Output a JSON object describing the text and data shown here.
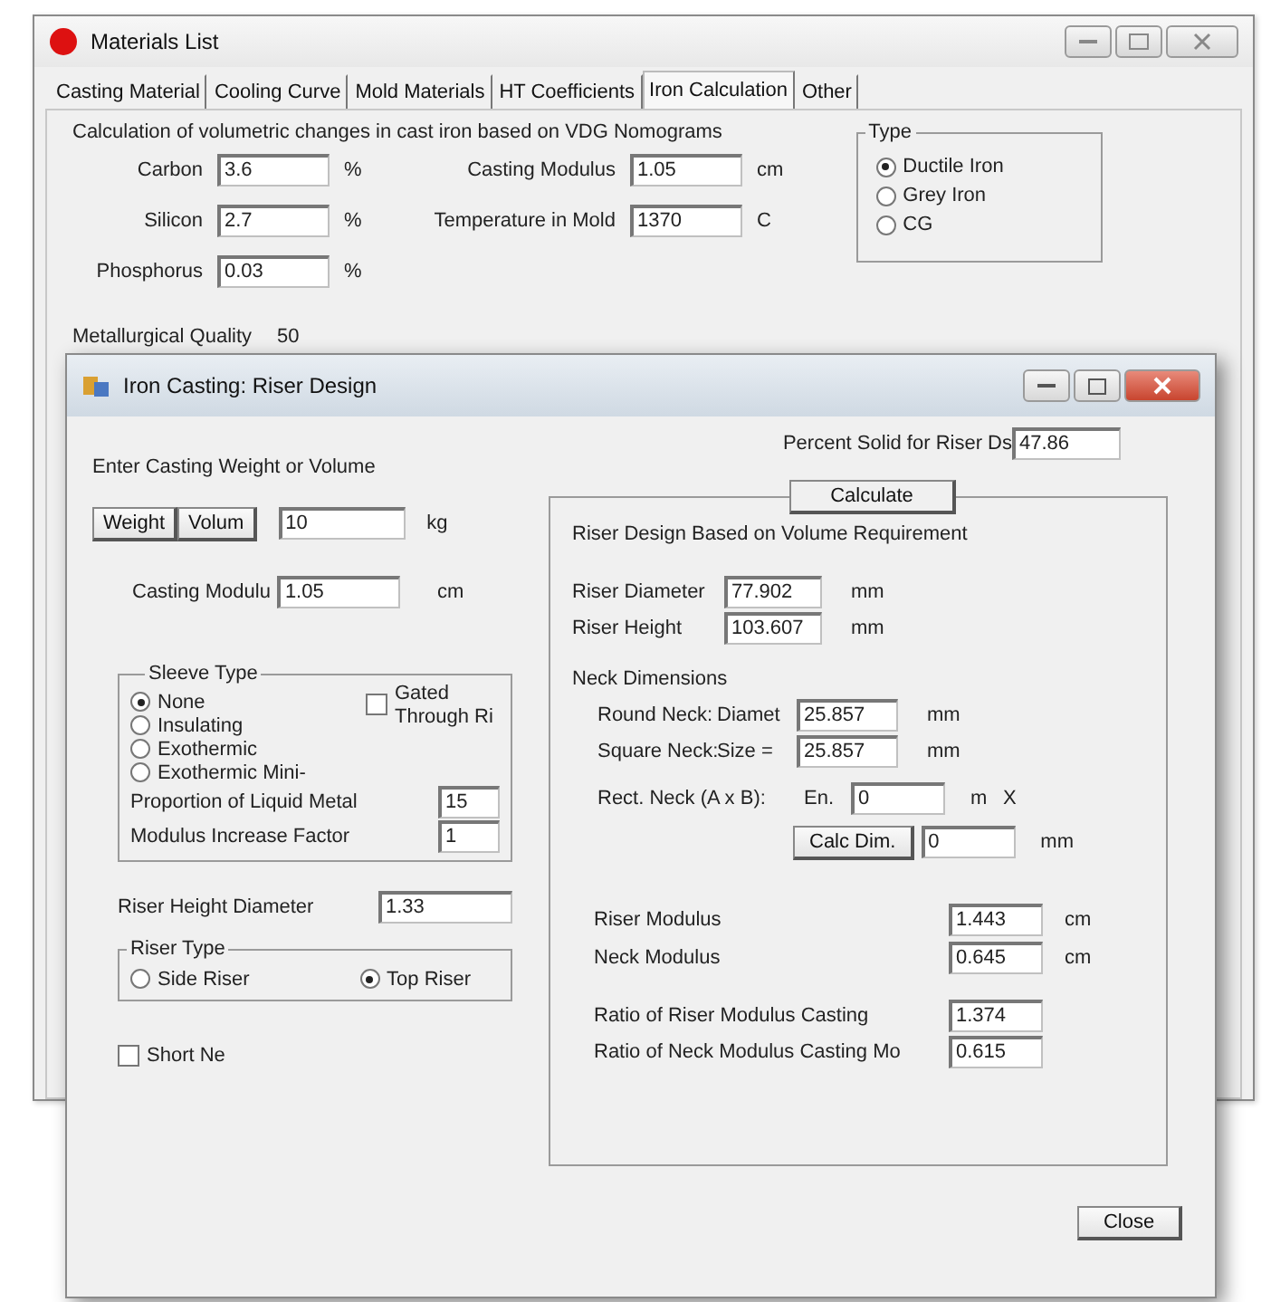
{
  "main_window": {
    "title": "Materials List",
    "tabs": [
      {
        "label": "Casting Material",
        "selected": false
      },
      {
        "label": "Cooling Curve",
        "selected": false
      },
      {
        "label": "Mold Materials",
        "selected": false
      },
      {
        "label": "HT Coefficients",
        "selected": false
      },
      {
        "label": "Iron Calculation",
        "selected": true
      },
      {
        "label": "Other",
        "selected": false
      }
    ],
    "description": "Calculation of volumetric changes in cast iron based on VDG Nomograms",
    "left_fields": [
      {
        "label": "Carbon",
        "value": "3.6",
        "unit": "%"
      },
      {
        "label": "Silicon",
        "value": "2.7",
        "unit": "%"
      },
      {
        "label": "Phosphorus",
        "value": "0.03",
        "unit": "%"
      }
    ],
    "right_fields": [
      {
        "label": "Casting Modulus",
        "value": "1.05",
        "unit": "cm"
      },
      {
        "label": "Temperature in Mold",
        "value": "1370",
        "unit": "C"
      }
    ],
    "type_group": {
      "title": "Type",
      "options": [
        {
          "label": "Ductile Iron",
          "selected": true
        },
        {
          "label": "Grey Iron",
          "selected": false
        },
        {
          "label": "CG",
          "selected": false
        }
      ]
    },
    "metallurgical_quality": {
      "label": "Metallurgical Quality",
      "value": "50"
    }
  },
  "dialog": {
    "title": "Iron Casting: Riser Design",
    "prompt": "Enter Casting Weight or Volume",
    "mode_buttons": [
      {
        "label": "Weight"
      },
      {
        "label": "Volum"
      }
    ],
    "weight": {
      "value": "10",
      "unit": "kg"
    },
    "casting_modulus": {
      "label": "Casting Modulu",
      "value": "1.05",
      "unit": "cm"
    },
    "sleeve_group": {
      "title": "Sleeve Type",
      "options": [
        {
          "label": "None",
          "selected": true
        },
        {
          "label": "Insulating",
          "selected": false
        },
        {
          "label": "Exothermic",
          "selected": false
        },
        {
          "label": "Exothermic Mini-",
          "selected": false
        }
      ],
      "gated": {
        "label": "Gated Through Ri",
        "checked": false
      },
      "fields": [
        {
          "label": "Proportion of Liquid Metal",
          "value": "15"
        },
        {
          "label": "Modulus Increase Factor",
          "value": "1"
        }
      ]
    },
    "riser_height_diameter": {
      "label": "Riser Height Diameter",
      "value": "1.33"
    },
    "riser_type": {
      "title": "Riser Type",
      "options": [
        {
          "label": "Side Riser",
          "selected": false
        },
        {
          "label": "Top Riser",
          "selected": true
        }
      ]
    },
    "short_neck": {
      "label": "Short Ne",
      "checked": false
    },
    "percent_solid": {
      "label": "Percent Solid for Riser Ds",
      "value": "47.86"
    },
    "calculate_button": "Calculate",
    "result_title": "Riser Design Based on Volume Requirement",
    "riser_fields": [
      {
        "label": "Riser Diameter",
        "value": "77.902",
        "unit": "mm"
      },
      {
        "label": "Riser Height",
        "value": "103.607",
        "unit": "mm"
      }
    ],
    "neck_title": "Neck Dimensions",
    "neck_fields": [
      {
        "label": "Round Neck:",
        "sublabel": "Diamet",
        "value": "25.857",
        "unit": "mm"
      },
      {
        "label": "Square Neck:",
        "sublabel": "Size =",
        "value": "25.857",
        "unit": "mm"
      }
    ],
    "rect_neck": {
      "label": "Rect. Neck (A x B):",
      "sublabel": "En.",
      "value": "0",
      "unit": "m",
      "suffix": "X"
    },
    "calc_dim": {
      "button": "Calc Dim.",
      "value": "0",
      "unit": "mm"
    },
    "modulus_fields": [
      {
        "label": "Riser Modulus",
        "value": "1.443",
        "unit": "cm"
      },
      {
        "label": "Neck Modulus",
        "value": "0.645",
        "unit": "cm"
      }
    ],
    "ratio_fields": [
      {
        "label": "Ratio of Riser Modulus  Casting",
        "value": "1.374"
      },
      {
        "label": "Ratio of Neck Modulus  Casting Mo",
        "value": "0.615"
      }
    ],
    "close_button": "Close"
  }
}
